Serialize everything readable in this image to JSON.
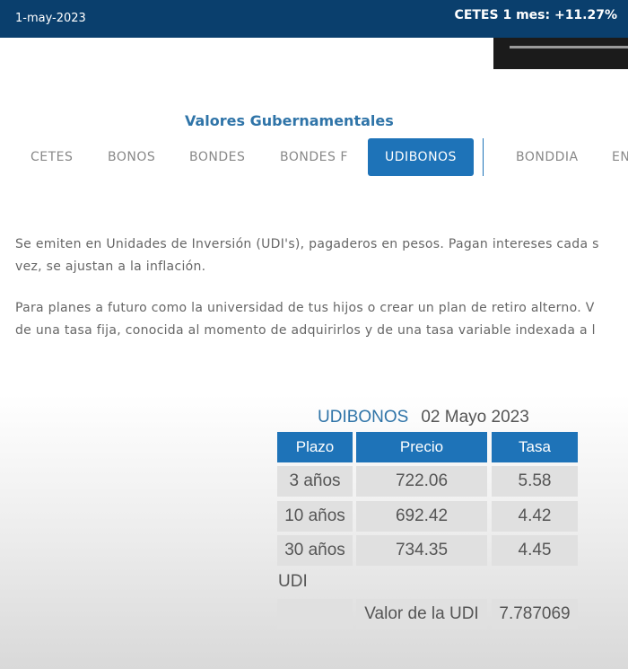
{
  "topbar": {
    "date": "1-may-2023",
    "ticker": "CETES 1 mes: +11.27%"
  },
  "section": {
    "title": "Valores Gubernamentales"
  },
  "tabs": [
    {
      "label": "CETES"
    },
    {
      "label": "BONOS"
    },
    {
      "label": "BONDES"
    },
    {
      "label": "BONDES F"
    },
    {
      "label": "UDIBONOS",
      "active": true
    },
    {
      "label": "BONDDIA"
    },
    {
      "label": "EN"
    }
  ],
  "description": {
    "p1_line1": "Se emiten en Unidades de Inversión (UDI's), pagaderos en pesos. Pagan intereses cada s",
    "p1_line2": "vez, se ajustan a la inflación.",
    "p2_line1": "Para planes a futuro como la universidad de tus hijos o crear un plan de retiro alterno. V",
    "p2_line2": "de una tasa fija, conocida al momento de adquirirlos y de una tasa variable indexada a l"
  },
  "table": {
    "name": "UDIBONOS",
    "date": "02 Mayo 2023",
    "headers": [
      "Plazo",
      "Precio",
      "Tasa"
    ],
    "rows": [
      [
        "3 años",
        "722.06",
        "5.58"
      ],
      [
        "10 años",
        "692.42",
        "4.42"
      ],
      [
        "30 años",
        "734.35",
        "4.45"
      ]
    ],
    "udi_label": "UDI",
    "udi_value_label": "Valor de la UDI",
    "udi_value": "7.787069"
  },
  "colors": {
    "topbar": "#0a3f6d",
    "accent": "#1e73b8",
    "title": "#2f74a8"
  }
}
